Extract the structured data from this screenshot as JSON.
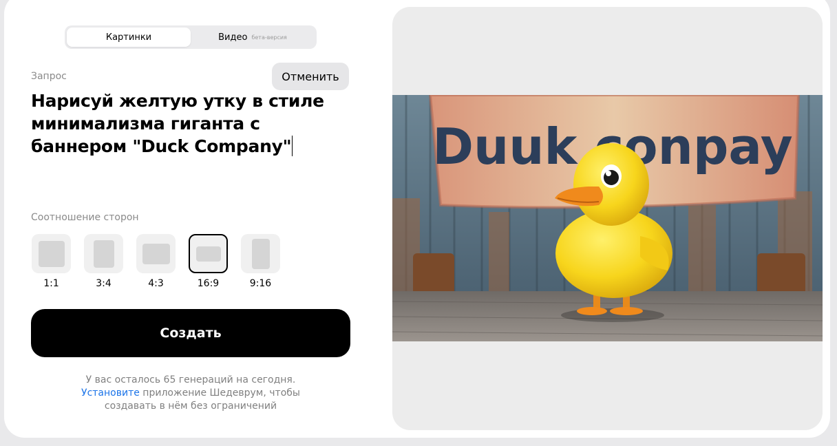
{
  "tabs": {
    "images_label": "Картинки",
    "video_label": "Видео",
    "video_badge": "бета-версия",
    "active": "images"
  },
  "request": {
    "label": "Запрос",
    "cancel_label": "Отменить",
    "prompt_text": "Нарисуй желтую утку в стиле минимализма гиганта с баннером \"Duck Company\""
  },
  "aspect_ratio": {
    "label": "Соотношение сторон",
    "options": [
      "1:1",
      "3:4",
      "4:3",
      "16:9",
      "9:16"
    ],
    "selected": "16:9"
  },
  "create_label": "Создать",
  "footer": {
    "line1": "У вас осталось 65 генераций на сегодня.",
    "install_link": "Установите",
    "line2": " приложение Шедеврум, чтобы",
    "line3": "создавать в нём без ограничений"
  },
  "generated_image": {
    "banner_text": "Duuk conpay",
    "subject": "yellow-duck",
    "colors": {
      "duck": "#f7d51c",
      "beak": "#f08a1c",
      "banner": "#e2b48c",
      "banner_text": "#2c3e5a",
      "wall": "#5d7d8f",
      "floor": "#8b8580"
    }
  }
}
